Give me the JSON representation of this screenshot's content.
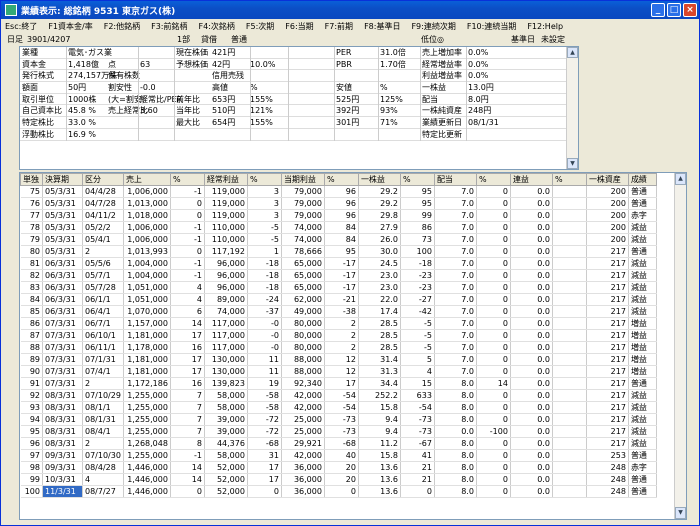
{
  "window": {
    "title": "業績表示: 総銘柄 9531 東京ガス(株)"
  },
  "menu": [
    "Esc:終了",
    "F1資本金/率",
    "F2:他銘柄",
    "F3:前銘柄",
    "F4:次銘柄",
    "F5:次期",
    "F6:当期",
    "F7:前期",
    "F8:基準日",
    "F9:連続次期",
    "F10:連続当期",
    "F12:Help"
  ],
  "info": {
    "date_label": "日足",
    "code_date": "3901/4207",
    "market": "1部",
    "trade": "貸借",
    "type": "普通",
    "low_label": "低位◎",
    "base_label": "基準日",
    "base_value": "未設定"
  },
  "info_rows": [
    [
      "業種",
      "電気･ガス業",
      "",
      "",
      "現在株価",
      "421円",
      "",
      "",
      "PER",
      "31.0倍",
      "売上増加率",
      "0.0%"
    ],
    [
      "資本金",
      "1,418億",
      "点",
      "63",
      "予想株価",
      "42円",
      "10.0%",
      "",
      "PBR",
      "1.70倍",
      "経常増益率",
      "0.0%"
    ],
    [
      "発行株式",
      "274,157万株",
      "保有株数",
      "",
      "",
      "信用売残",
      "",
      "",
      "",
      "",
      "利益増益率",
      "0.0%"
    ],
    [
      "額面",
      "50円",
      "割安性",
      "-0.0",
      "",
      "高値",
      "%",
      "",
      "安値",
      "%",
      "一株益",
      "13.0円"
    ],
    [
      "取引単位",
      "1000株",
      "(大=割安)",
      "経常比/PER",
      "前年比",
      "653円",
      "155%",
      "",
      "525円",
      "125%",
      "配当",
      "8.0円"
    ],
    [
      "自己資本比",
      "45.8 %",
      "売上経常比",
      "3.60",
      "当年比",
      "510円",
      "121%",
      "",
      "392円",
      "93%",
      "一株純資産",
      "248円"
    ],
    [
      "特定株比",
      "33.0 %",
      "",
      "",
      "最大比",
      "654円",
      "155%",
      "",
      "301円",
      "71%",
      "業績更新日",
      "08/1/31"
    ],
    [
      "浮動株比",
      "16.9 %",
      "",
      "",
      "",
      "",
      "",
      "",
      "",
      "",
      "特定比更新",
      ""
    ]
  ],
  "table": {
    "headers": [
      "単独",
      "決算期",
      "区分",
      "売上",
      "%",
      "経常利益",
      "%",
      "当期利益",
      "%",
      "一株益",
      "%",
      "配当",
      "%",
      "連益",
      "%",
      "一株資産",
      "成績"
    ],
    "rows": [
      [
        "75",
        "05/3/31",
        "04/4/28",
        "1,006,000",
        "-1",
        "119,000",
        "3",
        "79,000",
        "96",
        "29.2",
        "95",
        "7.0",
        "0",
        "0.0",
        "",
        "200",
        "普通"
      ],
      [
        "76",
        "05/3/31",
        "04/7/28",
        "1,013,000",
        "0",
        "119,000",
        "3",
        "79,000",
        "96",
        "29.2",
        "95",
        "7.0",
        "0",
        "0.0",
        "",
        "200",
        "普通"
      ],
      [
        "77",
        "05/3/31",
        "04/11/2",
        "1,018,000",
        "0",
        "119,000",
        "3",
        "79,000",
        "96",
        "29.8",
        "99",
        "7.0",
        "0",
        "0.0",
        "",
        "200",
        "赤字"
      ],
      [
        "78",
        "05/3/31",
        "05/2/2",
        "1,006,000",
        "-1",
        "110,000",
        "-5",
        "74,000",
        "84",
        "27.9",
        "86",
        "7.0",
        "0",
        "0.0",
        "",
        "200",
        "減益"
      ],
      [
        "79",
        "05/3/31",
        "05/4/1",
        "1,006,000",
        "-1",
        "110,000",
        "-5",
        "74,000",
        "84",
        "26.0",
        "73",
        "7.0",
        "0",
        "0.0",
        "",
        "200",
        "減益"
      ],
      [
        "80",
        "05/3/31",
        "2",
        "1,013,993",
        "0",
        "117,192",
        "1",
        "78,666",
        "95",
        "30.0",
        "100",
        "7.0",
        "0",
        "0.0",
        "",
        "217",
        "普通"
      ],
      [
        "81",
        "06/3/31",
        "05/5/6",
        "1,004,000",
        "-1",
        "96,000",
        "-18",
        "65,000",
        "-17",
        "24.5",
        "-18",
        "7.0",
        "0",
        "0.0",
        "",
        "217",
        "減益"
      ],
      [
        "82",
        "06/3/31",
        "05/7/1",
        "1,004,000",
        "-1",
        "96,000",
        "-18",
        "65,000",
        "-17",
        "23.0",
        "-23",
        "7.0",
        "0",
        "0.0",
        "",
        "217",
        "減益"
      ],
      [
        "83",
        "06/3/31",
        "05/7/28",
        "1,051,000",
        "4",
        "96,000",
        "-18",
        "65,000",
        "-17",
        "23.0",
        "-23",
        "7.0",
        "0",
        "0.0",
        "",
        "217",
        "減益"
      ],
      [
        "84",
        "06/3/31",
        "06/1/1",
        "1,051,000",
        "4",
        "89,000",
        "-24",
        "62,000",
        "-21",
        "22.0",
        "-27",
        "7.0",
        "0",
        "0.0",
        "",
        "217",
        "減益"
      ],
      [
        "85",
        "06/3/31",
        "06/4/1",
        "1,070,000",
        "6",
        "74,000",
        "-37",
        "49,000",
        "-38",
        "17.4",
        "-42",
        "7.0",
        "0",
        "0.0",
        "",
        "217",
        "減益"
      ],
      [
        "86",
        "07/3/31",
        "06/7/1",
        "1,157,000",
        "14",
        "117,000",
        "-0",
        "80,000",
        "2",
        "28.5",
        "-5",
        "7.0",
        "0",
        "0.0",
        "",
        "217",
        "増益"
      ],
      [
        "87",
        "07/3/31",
        "06/10/1",
        "1,181,000",
        "17",
        "117,000",
        "-0",
        "80,000",
        "2",
        "28.5",
        "-5",
        "7.0",
        "0",
        "0.0",
        "",
        "217",
        "増益"
      ],
      [
        "88",
        "07/3/31",
        "06/11/1",
        "1,178,000",
        "16",
        "117,000",
        "-0",
        "80,000",
        "2",
        "28.5",
        "-5",
        "7.0",
        "0",
        "0.0",
        "",
        "217",
        "増益"
      ],
      [
        "89",
        "07/3/31",
        "07/1/31",
        "1,181,000",
        "17",
        "130,000",
        "11",
        "88,000",
        "12",
        "31.4",
        "5",
        "7.0",
        "0",
        "0.0",
        "",
        "217",
        "増益"
      ],
      [
        "90",
        "07/3/31",
        "07/4/1",
        "1,181,000",
        "17",
        "130,000",
        "11",
        "88,000",
        "12",
        "31.3",
        "4",
        "7.0",
        "0",
        "0.0",
        "",
        "217",
        "増益"
      ],
      [
        "91",
        "07/3/31",
        "2",
        "1,172,186",
        "16",
        "139,823",
        "19",
        "92,340",
        "17",
        "34.4",
        "15",
        "8.0",
        "14",
        "0.0",
        "",
        "217",
        "普通"
      ],
      [
        "92",
        "08/3/31",
        "07/10/29",
        "1,255,000",
        "7",
        "58,000",
        "-58",
        "42,000",
        "-54",
        "252.2",
        "633",
        "8.0",
        "0",
        "0.0",
        "",
        "217",
        "減益"
      ],
      [
        "93",
        "08/3/31",
        "08/1/1",
        "1,255,000",
        "7",
        "58,000",
        "-58",
        "42,000",
        "-54",
        "15.8",
        "-54",
        "8.0",
        "0",
        "0.0",
        "",
        "217",
        "減益"
      ],
      [
        "94",
        "08/3/31",
        "08/1/31",
        "1,255,000",
        "7",
        "39,000",
        "-72",
        "25,000",
        "-73",
        "9.4",
        "-73",
        "8.0",
        "0",
        "0.0",
        "",
        "217",
        "減益"
      ],
      [
        "95",
        "08/3/31",
        "08/4/1",
        "1,255,000",
        "7",
        "39,000",
        "-72",
        "25,000",
        "-73",
        "9.4",
        "-73",
        "0.0",
        "-100",
        "0.0",
        "",
        "217",
        "減益"
      ],
      [
        "96",
        "08/3/31",
        "2",
        "1,268,048",
        "8",
        "44,376",
        "-68",
        "29,921",
        "-68",
        "11.2",
        "-67",
        "8.0",
        "0",
        "0.0",
        "",
        "217",
        "減益"
      ],
      [
        "97",
        "09/3/31",
        "07/10/30",
        "1,255,000",
        "-1",
        "58,000",
        "31",
        "42,000",
        "40",
        "15.8",
        "41",
        "8.0",
        "0",
        "0.0",
        "",
        "253",
        "普通"
      ],
      [
        "98",
        "09/3/31",
        "08/4/28",
        "1,446,000",
        "14",
        "52,000",
        "17",
        "36,000",
        "20",
        "13.6",
        "21",
        "8.0",
        "0",
        "0.0",
        "",
        "248",
        "赤字"
      ],
      [
        "99",
        "10/3/31",
        "4",
        "1,446,000",
        "14",
        "52,000",
        "17",
        "36,000",
        "20",
        "13.6",
        "21",
        "8.0",
        "0",
        "0.0",
        "",
        "248",
        "普通"
      ],
      [
        "100",
        "11/3/31",
        "08/7/27",
        "1,446,000",
        "0",
        "52,000",
        "0",
        "36,000",
        "0",
        "13.6",
        "0",
        "8.0",
        "0",
        "0.0",
        "",
        "248",
        "普通"
      ]
    ]
  }
}
